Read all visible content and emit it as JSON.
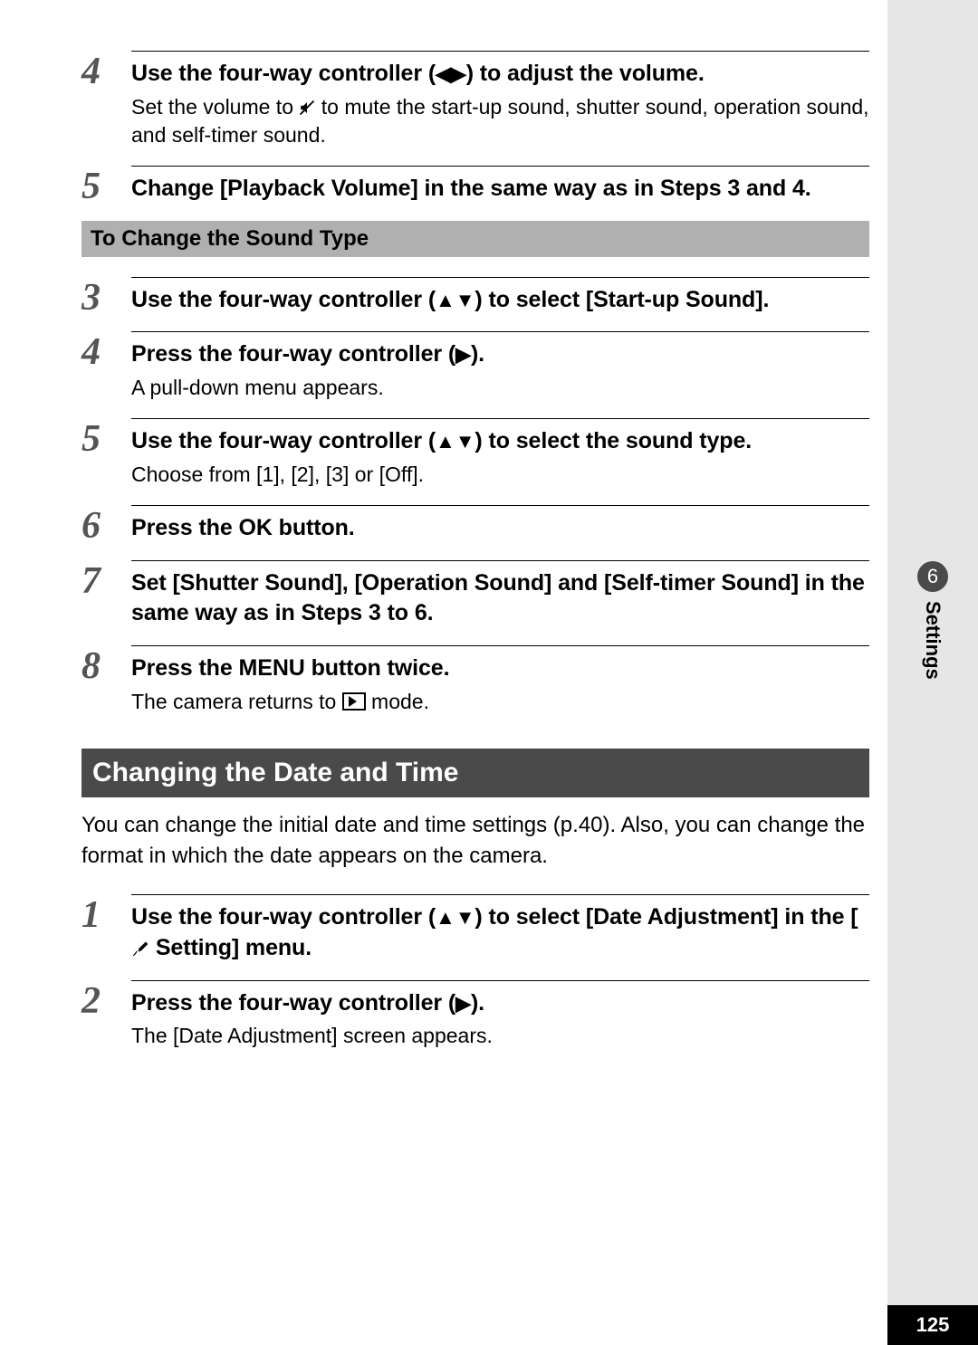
{
  "glyphs": {
    "left": "◀",
    "right": "▶",
    "up": "▲",
    "down": "▼"
  },
  "steps_top": [
    {
      "num": "4",
      "title_parts": [
        "Use the four-way controller (",
        "LR",
        ") to adjust the volume."
      ],
      "desc_parts": [
        "Set the volume to ",
        "MUTE",
        " to mute the start-up sound, shutter sound, operation sound, and self-timer sound."
      ]
    },
    {
      "num": "5",
      "title_parts": [
        "Change [Playback Volume] in the same way as in Steps 3 and 4."
      ],
      "desc_parts": []
    }
  ],
  "sound_type_heading": "To Change the Sound Type",
  "steps_sound": [
    {
      "num": "3",
      "title_parts": [
        "Use the four-way controller (",
        "UD",
        ") to select [Start-up Sound]."
      ],
      "desc_parts": []
    },
    {
      "num": "4",
      "title_parts": [
        "Press the four-way controller (",
        "R",
        ")."
      ],
      "desc_parts": [
        "A pull-down menu appears."
      ]
    },
    {
      "num": "5",
      "title_parts": [
        "Use the four-way controller (",
        "UD",
        ") to select the sound type."
      ],
      "desc_parts": [
        "Choose from [1], [2], [3] or [Off]."
      ]
    },
    {
      "num": "6",
      "title_parts": [
        "Press the ",
        "OK",
        " button."
      ],
      "desc_parts": []
    },
    {
      "num": "7",
      "title_parts": [
        "Set [Shutter Sound], [Operation Sound] and [Self-timer Sound] in the same way as in Steps 3 to 6."
      ],
      "desc_parts": []
    },
    {
      "num": "8",
      "title_parts": [
        "Press the ",
        "MENU",
        " button twice."
      ],
      "desc_parts": [
        "The camera returns to ",
        "PLAY",
        " mode."
      ]
    }
  ],
  "section_title": "Changing the Date and Time",
  "section_intro": "You can change the initial date and time settings (p.40). Also, you can change the format in which the date appears on the camera.",
  "steps_date": [
    {
      "num": "1",
      "title_parts": [
        "Use the four-way controller (",
        "UD",
        ") to select [Date Adjustment] in the [",
        "TOOL",
        " Setting] menu."
      ],
      "desc_parts": []
    },
    {
      "num": "2",
      "title_parts": [
        "Press the four-way controller (",
        "R",
        ")."
      ],
      "desc_parts": [
        "The [Date Adjustment] screen appears."
      ]
    }
  ],
  "side_tab": {
    "num": "6",
    "label": "Settings"
  },
  "page_number": "125"
}
